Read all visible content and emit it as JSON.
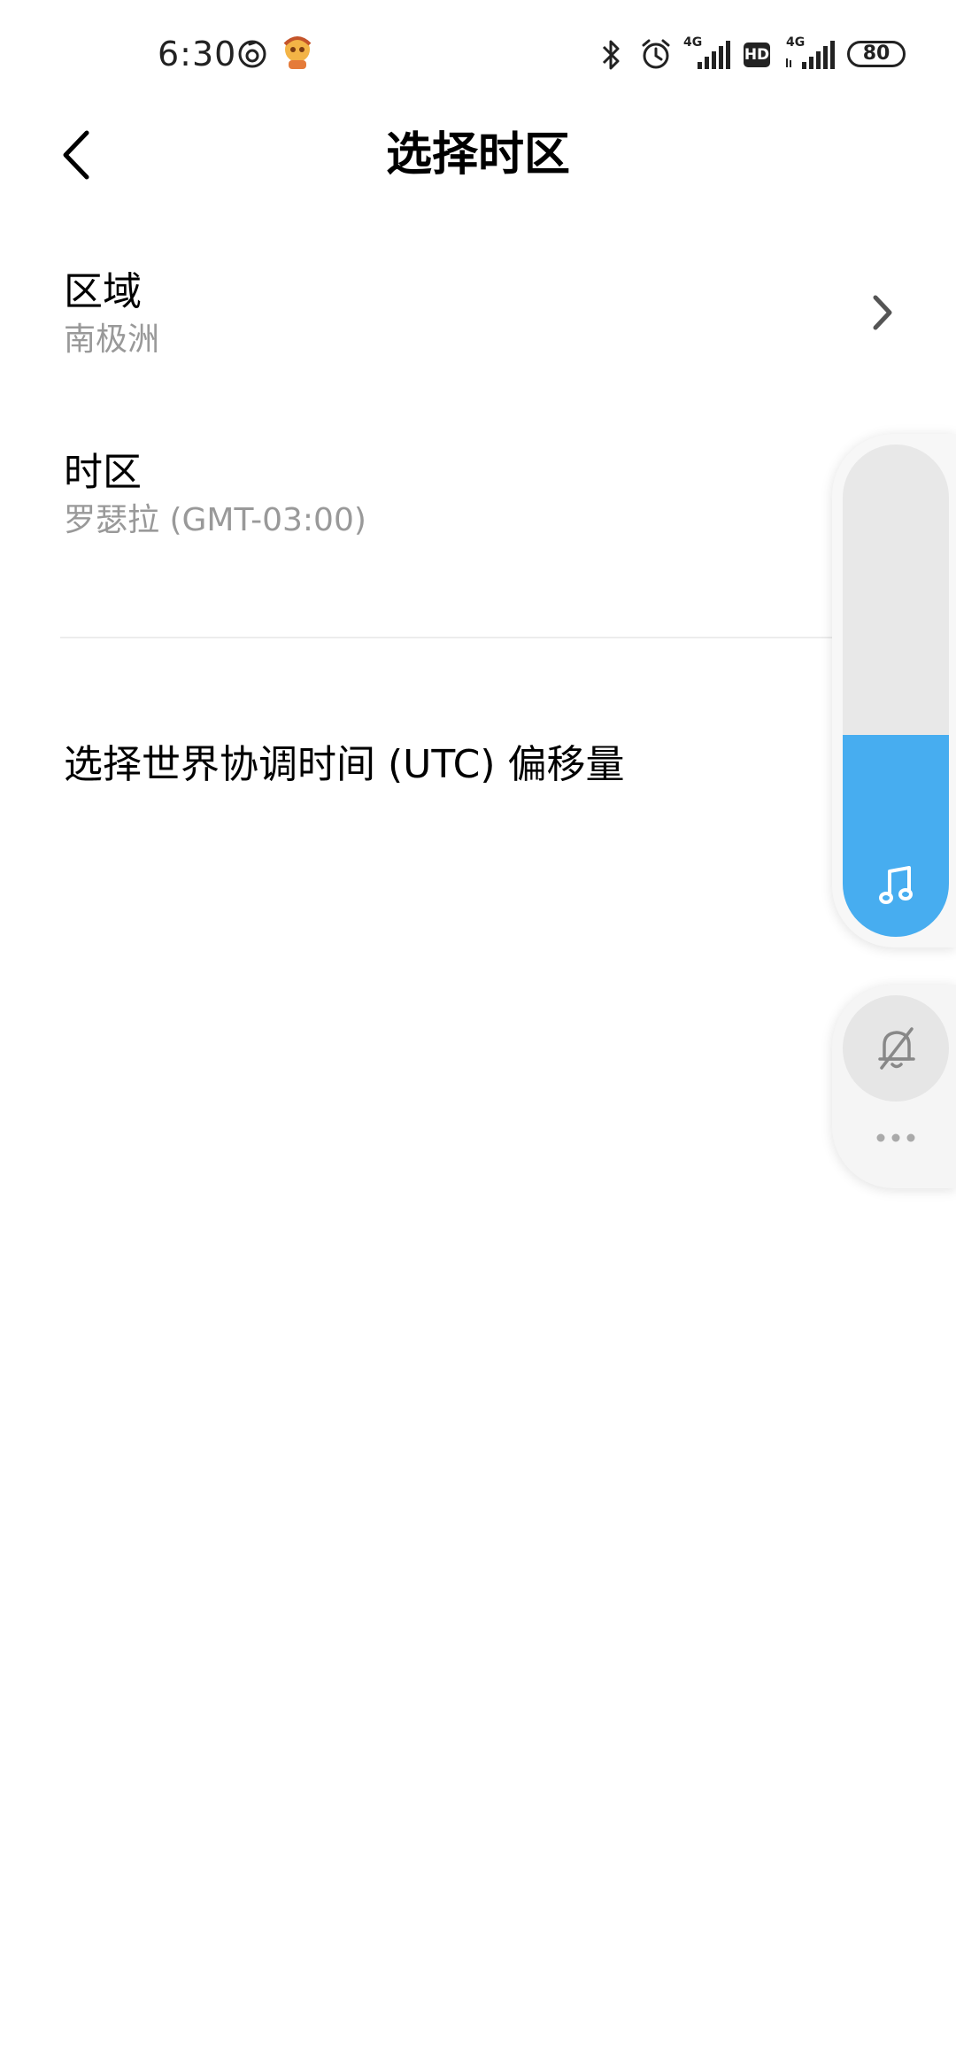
{
  "status_bar": {
    "time": "6:30",
    "network_1": "4G",
    "network_2": "4G",
    "hd_badge": "HD",
    "battery": "80",
    "icons": [
      "netease-music-icon",
      "avatar-app-icon",
      "bluetooth-icon",
      "alarm-icon",
      "signal-icon",
      "hd-icon",
      "signal-icon",
      "battery-icon"
    ]
  },
  "header": {
    "title": "选择时区",
    "back_icon": "back-arrow-icon"
  },
  "settings": {
    "region": {
      "title": "区域",
      "value": "南极洲"
    },
    "timezone": {
      "title": "时区",
      "value": "罗瑟拉 (GMT-03:00)"
    },
    "utc_offset": {
      "title": "选择世界协调时间 (UTC) 偏移量"
    }
  },
  "volume_overlay": {
    "media_volume_fraction": 0.41,
    "fill_color": "#47ADF0",
    "icons": [
      "music-note-icon",
      "bell-muted-icon",
      "more-icon"
    ]
  }
}
